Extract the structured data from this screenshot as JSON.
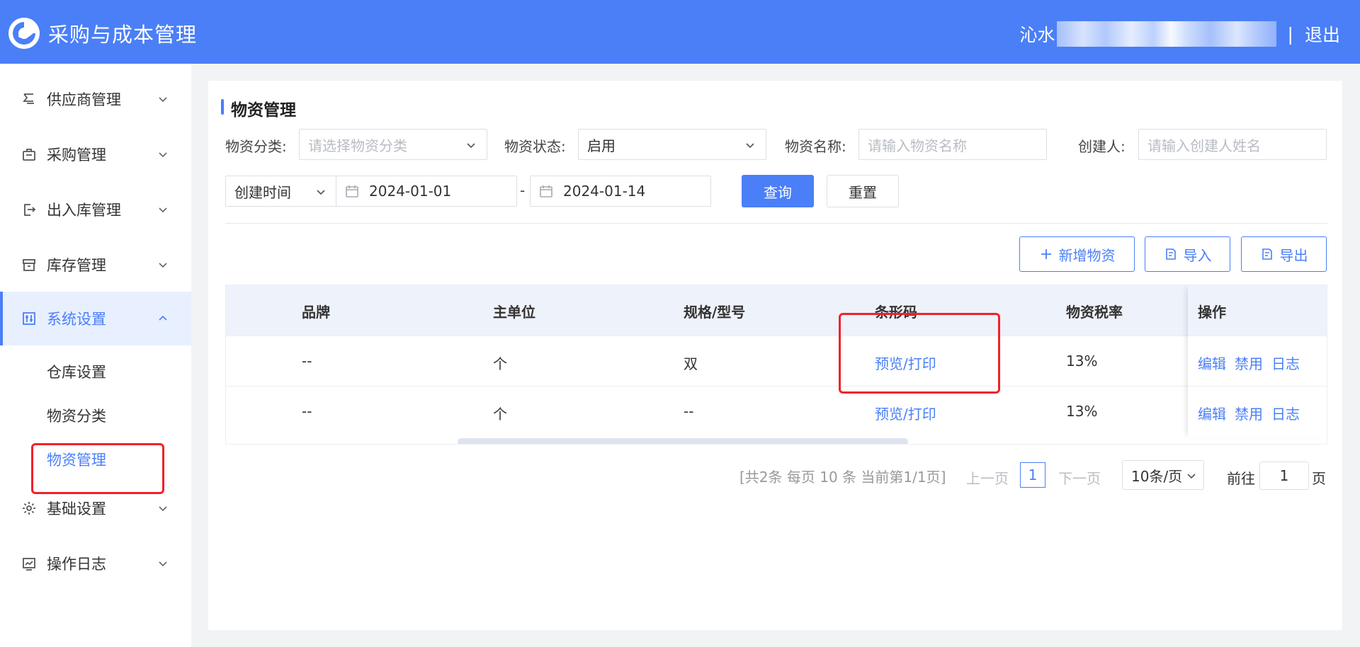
{
  "header": {
    "app_title": "采购与成本管理",
    "user_name": "沁水",
    "separator": "|",
    "logout": "退出"
  },
  "sidebar": {
    "items": [
      {
        "label": "供应商管理",
        "icon": "supplier-icon"
      },
      {
        "label": "采购管理",
        "icon": "purchase-icon"
      },
      {
        "label": "出入库管理",
        "icon": "inout-icon"
      },
      {
        "label": "库存管理",
        "icon": "inventory-icon"
      },
      {
        "label": "系统设置",
        "icon": "settings-sliders-icon"
      },
      {
        "label": "基础设置",
        "icon": "gear-icon"
      },
      {
        "label": "操作日志",
        "icon": "log-chart-icon"
      }
    ],
    "sub_items": [
      "仓库设置",
      "物资分类",
      "物资管理"
    ]
  },
  "main": {
    "title": "物资管理",
    "filters": {
      "category_label": "物资分类:",
      "category_placeholder": "请选择物资分类",
      "status_label": "物资状态:",
      "status_value": "启用",
      "name_label": "物资名称:",
      "name_placeholder": "请输入物资名称",
      "creator_label": "创建人:",
      "creator_placeholder": "请输入创建人姓名",
      "date_type": "创建时间",
      "date_start": "2024-01-01",
      "date_sep": "-",
      "date_end": "2024-01-14",
      "query": "查询",
      "reset": "重置"
    },
    "actions": {
      "add": "新增物资",
      "import": "导入",
      "export": "导出"
    },
    "table": {
      "columns": [
        "品牌",
        "主单位",
        "规格/型号",
        "条形码",
        "物资税率",
        "操作"
      ],
      "rows": [
        {
          "brand": "--",
          "unit": "个",
          "spec": "双",
          "barcode": "预览/打印",
          "tax": "13%"
        },
        {
          "brand": "--",
          "unit": "个",
          "spec": "--",
          "barcode": "预览/打印",
          "tax": "13%"
        }
      ],
      "ops": [
        "编辑",
        "禁用",
        "日志"
      ]
    },
    "pagination": {
      "summary": "[共2条 每页 10 条 当前第1/1页]",
      "prev": "上一页",
      "current": "1",
      "next": "下一页",
      "page_size": "10条/页",
      "goto_label": "前往",
      "goto_value": "1",
      "goto_suffix": "页"
    }
  },
  "colors": {
    "brand": "#4a7ff7",
    "highlight_box": "#f0222b"
  }
}
